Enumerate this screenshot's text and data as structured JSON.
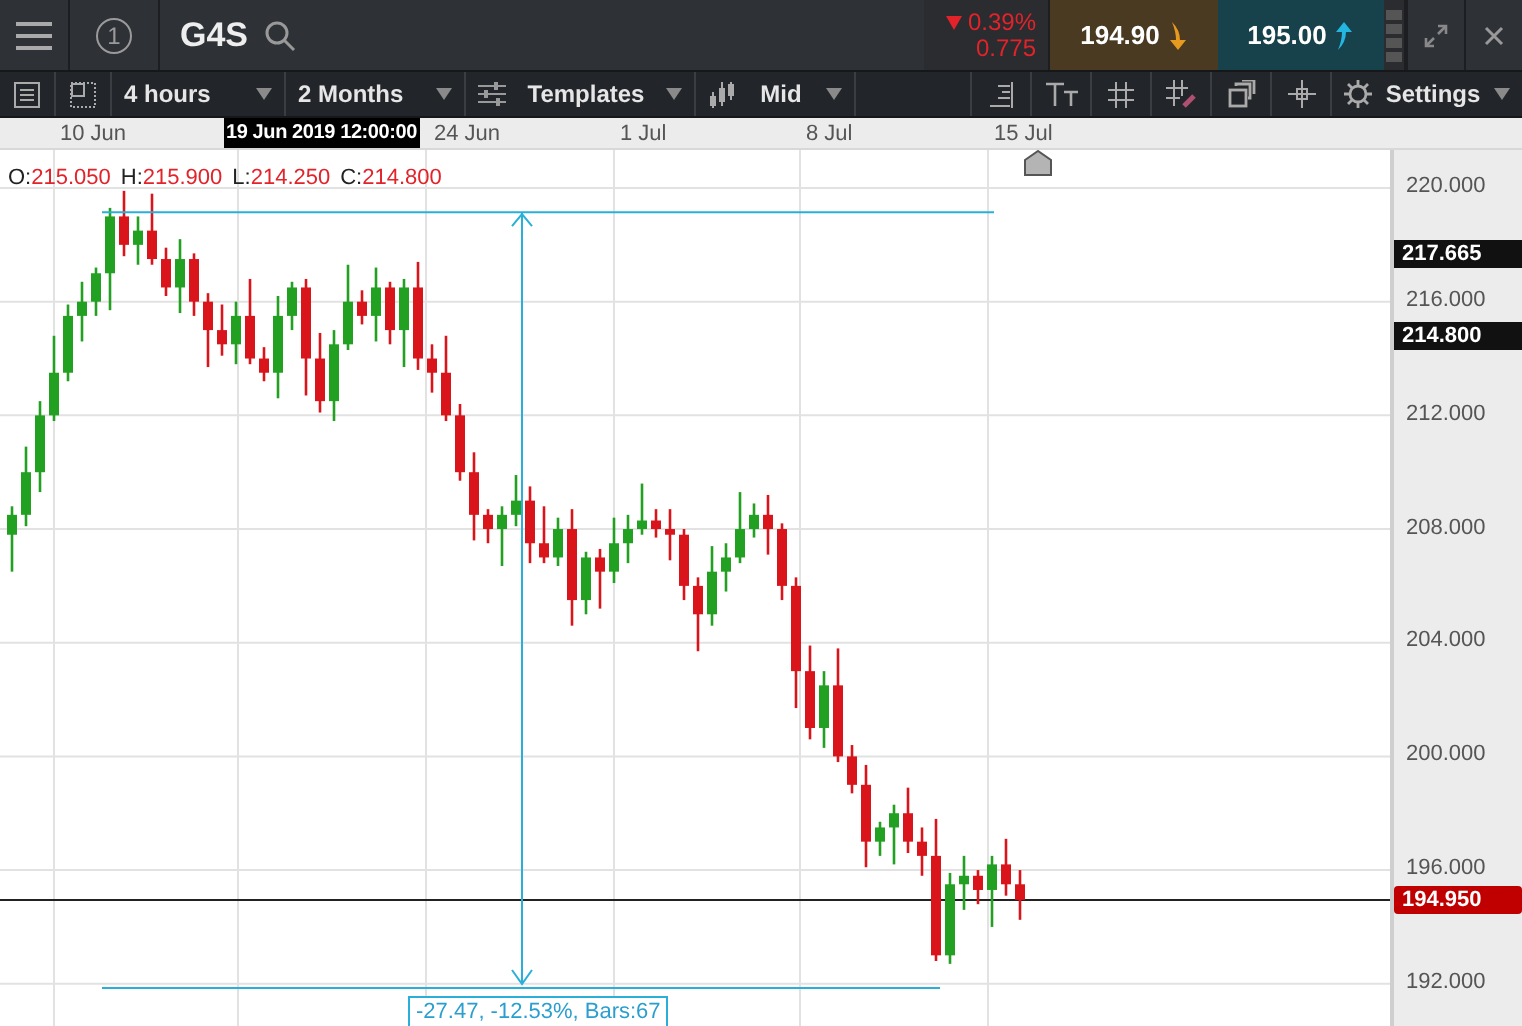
{
  "header": {
    "instrument_number": "1",
    "symbol": "G4S",
    "change": {
      "percent": "0.39%",
      "points": "0.775"
    },
    "sell": {
      "price": "194.90"
    },
    "buy": {
      "price": "195.00"
    }
  },
  "toolbar": {
    "interval": "4 hours",
    "range": "2 Months",
    "templates": "Templates",
    "price_type": "Mid",
    "settings": "Settings"
  },
  "chart": {
    "dates": [
      "10 Jun",
      "24 Jun",
      "1 Jul",
      "8 Jul",
      "15 Jul"
    ],
    "crosshair_date": "19 Jun 2019 12:00:00",
    "ohlc": [
      {
        "label": "O:",
        "value": "215.050"
      },
      {
        "label": "H:",
        "value": "215.900"
      },
      {
        "label": "L:",
        "value": "214.250"
      },
      {
        "label": "C:",
        "value": "214.800"
      }
    ],
    "price_ticks": [
      "220.000",
      "216.000",
      "212.000",
      "208.000",
      "204.000",
      "200.000",
      "196.000",
      "192.000"
    ],
    "price_labels": [
      {
        "value": "217.665",
        "kind": "marker"
      },
      {
        "value": "214.800",
        "kind": "marker"
      },
      {
        "value": "194.950",
        "kind": "current"
      }
    ],
    "measure": "-27.47, -12.53%, Bars:67"
  }
}
